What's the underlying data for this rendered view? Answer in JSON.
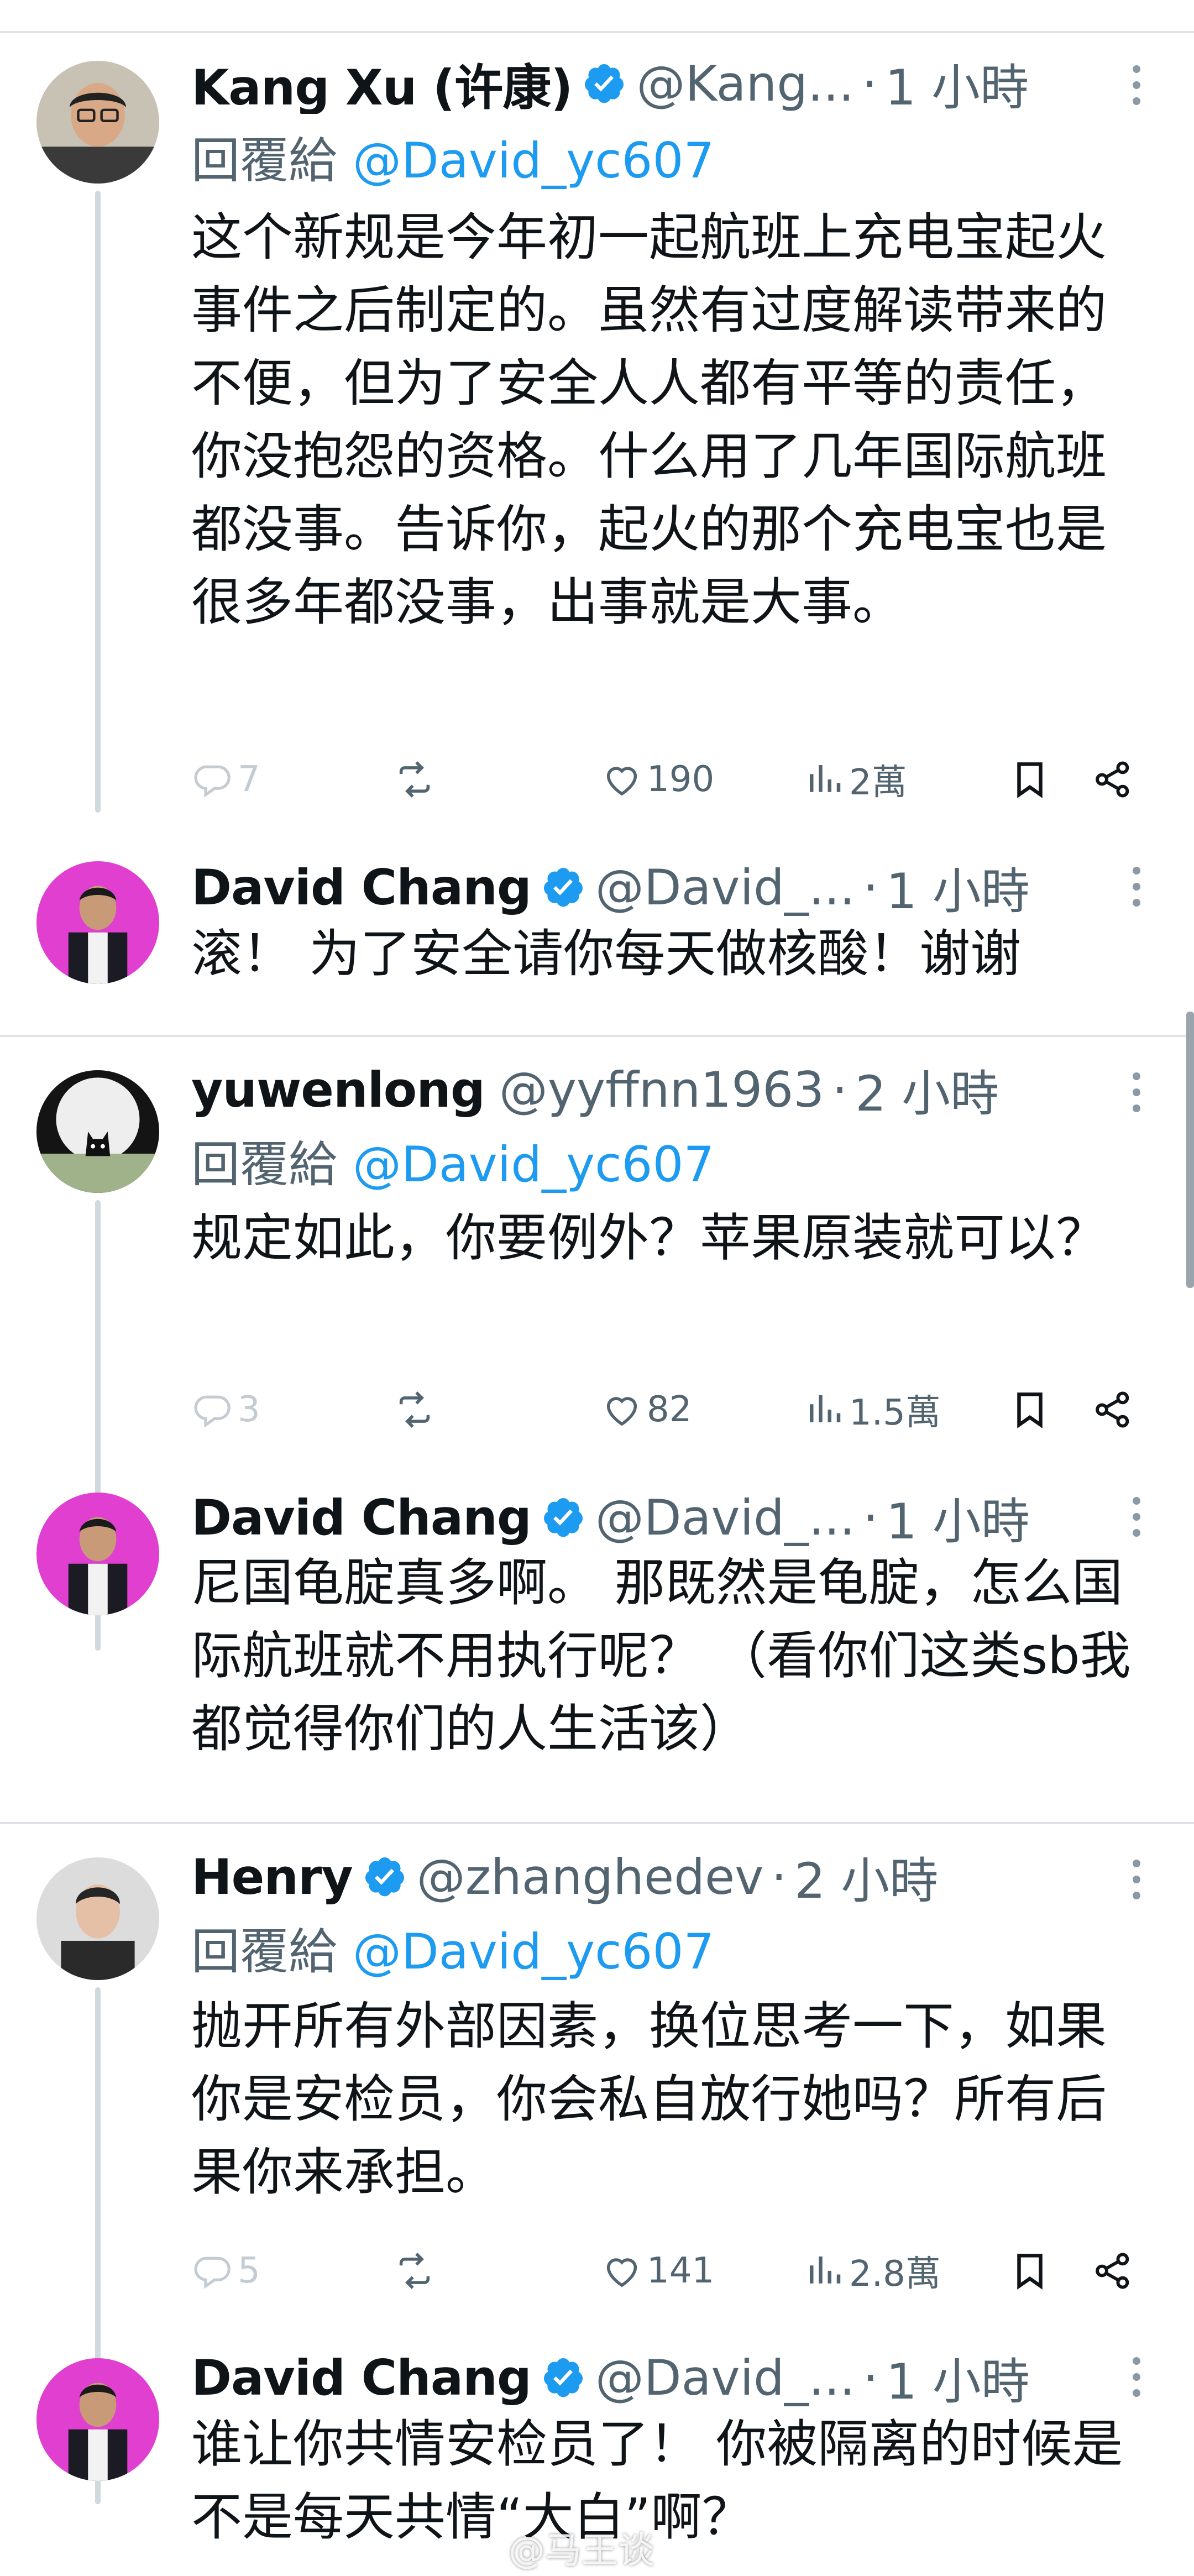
{
  "tweets": [
    {
      "name": "Kang Xu (许康)",
      "handle": "@Kang...",
      "dot": "·",
      "time": "1 小時",
      "reply_prefix": "回覆給",
      "reply_to": "@David_yc607",
      "text": "这个新规是今年初一起航班上充电宝起火事件之后制定的。虽然有过度解读带来的不便，但为了安全人人都有平等的责任，你没抱怨的资格。什么用了几年国际航班都没事。告诉你，起火的那个充电宝也是很多年都没事，出事就是大事。",
      "replies": "7",
      "retweets": "",
      "likes": "190",
      "views": "2萬"
    },
    {
      "name": "David Chang",
      "handle": "@David_...",
      "dot": "·",
      "time": "1 小時",
      "text": "滚！ 为了安全请你每天做核酸！谢谢"
    },
    {
      "name": "yuwenlong",
      "handle": "@yyffnn1963",
      "dot": "·",
      "time": "2 小時",
      "reply_prefix": "回覆給",
      "reply_to": "@David_yc607",
      "text": "规定如此，你要例外？苹果原装就可以？",
      "replies": "3",
      "retweets": "",
      "likes": "82",
      "views": "1.5萬"
    },
    {
      "name": "David Chang",
      "handle": "@David_...",
      "dot": "·",
      "time": "1 小時",
      "text": "尼国龟腚真多啊。 那既然是龟腚，怎么国际航班就不用执行呢？ （看你们这类sb我都觉得你们的人生活该）"
    },
    {
      "name": "Henry",
      "handle": "@zhanghedev",
      "dot": "·",
      "time": "2 小時",
      "reply_prefix": "回覆給",
      "reply_to": "@David_yc607",
      "text": "抛开所有外部因素，换位思考一下，如果你是安检员，你会私自放行她吗？所有后果你来承担。",
      "replies": "5",
      "retweets": "",
      "likes": "141",
      "views": "2.8萬"
    },
    {
      "name": "David Chang",
      "handle": "@David_...",
      "dot": "·",
      "time": "1 小時",
      "text": "谁让你共情安检员了！ 你被隔离的时候是不是每天共情“大白”啊？"
    }
  ],
  "watermark": "@马王谈",
  "colors": {
    "text": "#0f1419",
    "secondary": "#536471",
    "link": "#1d9bf0",
    "verified": "#1d9bf0",
    "thread_line": "#cfd9de",
    "separator": "#dfe3e7"
  },
  "icons": [
    "reply-icon",
    "retweet-icon",
    "like-icon",
    "views-icon",
    "bookmark-icon",
    "share-icon",
    "verified-badge-icon",
    "more-icon"
  ]
}
